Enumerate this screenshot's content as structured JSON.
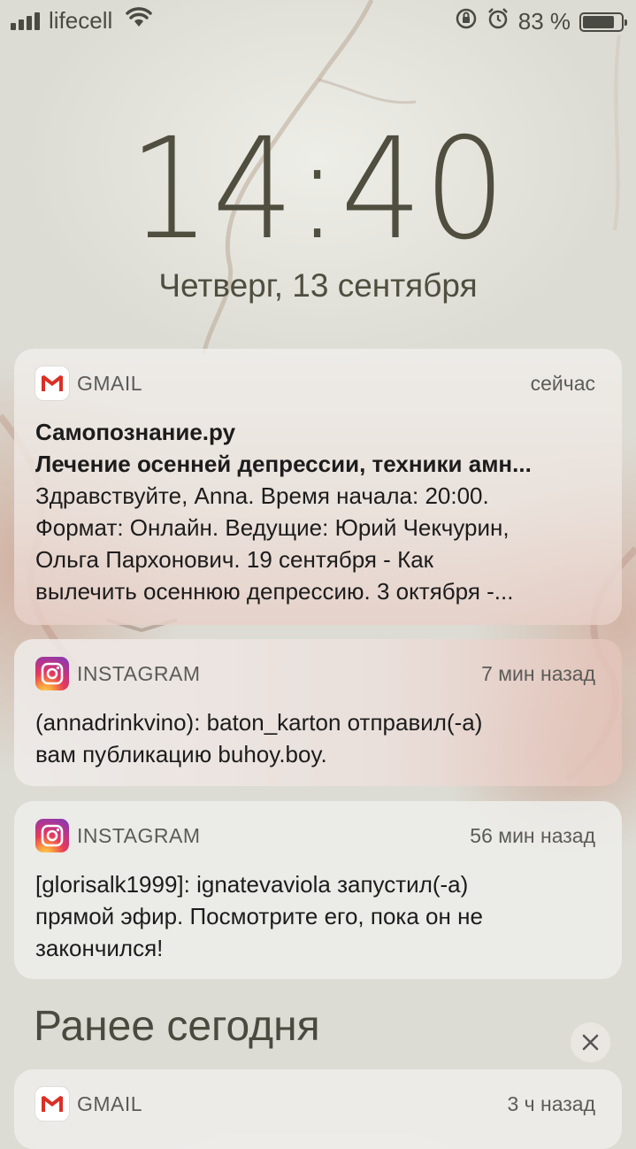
{
  "status_bar": {
    "carrier": "lifecell",
    "battery_percent": "83 %",
    "battery_level": 0.83
  },
  "lock_screen": {
    "time": "14:40",
    "date": "Четверг, 13 сентября"
  },
  "notifications": [
    {
      "app": "GMAIL",
      "time": "сейчас",
      "title": "Самопознание.ру",
      "subtitle": "Лечение осенней депрессии, техники амн...",
      "body_lines": [
        "Здравствуйте, Anna. Время начала: 20:00.",
        "Формат: Онлайн. Ведущие: Юрий Чекчурин,",
        "Ольга Пархонович. 19 сентября - Как",
        "вылечить осеннюю депрессию. 3 октября -..."
      ]
    },
    {
      "app": "INSTAGRAM",
      "time": "7 мин назад",
      "body_lines": [
        "(annadrinkvino): baton_karton отправил(-а)",
        "вам публикацию buhoy.boy."
      ]
    },
    {
      "app": "INSTAGRAM",
      "time": "56 мин назад",
      "body_lines": [
        "[glorisalk1999]: ignatevaviola запустил(-а)",
        "прямой эфир. Посмотрите его, пока он не",
        "закончился!"
      ]
    }
  ],
  "earlier": {
    "title": "Ранее сегодня",
    "notification": {
      "app": "GMAIL",
      "time": "3 ч назад"
    }
  },
  "icons": {
    "gmail": "gmail-icon",
    "instagram": "instagram-icon",
    "close": "close-icon"
  }
}
